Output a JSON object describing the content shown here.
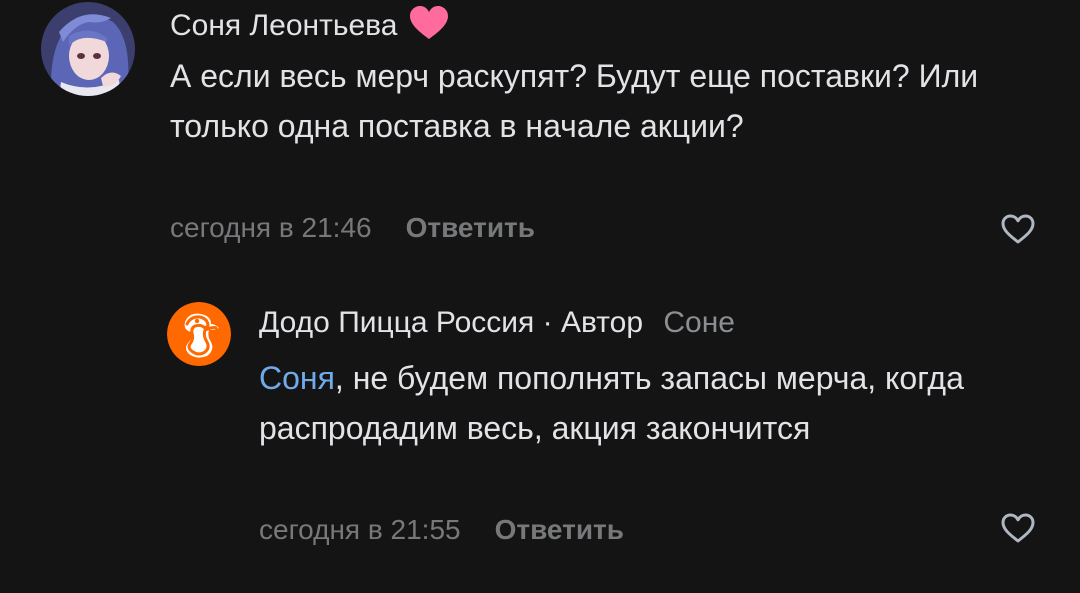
{
  "comments": [
    {
      "author": "Соня Леонтьева",
      "author_badge_icon": "pink-heart-icon",
      "text": "А если весь мерч раскупят? Будут еще поставки? Или только одна поставка в начале акции?",
      "time": "сегодня в 21:46",
      "reply_label": "Ответить",
      "like_icon": "heart-outline-icon"
    },
    {
      "author": "Додо Пицца Россия",
      "separator": "·",
      "role": "Автор",
      "reply_to": "Соне",
      "mention": "Соня",
      "text_rest": ", не будем пополнять запасы мерча, когда распродадим весь, акция закончится",
      "time": "сегодня в 21:55",
      "reply_label": "Ответить",
      "like_icon": "heart-outline-icon"
    }
  ],
  "colors": {
    "background": "#141414",
    "text": "#e1e3e6",
    "secondary": "#76787a",
    "mention": "#71aaeb",
    "badge": "#ff6b9d",
    "dodo_brand": "#ff6900"
  }
}
